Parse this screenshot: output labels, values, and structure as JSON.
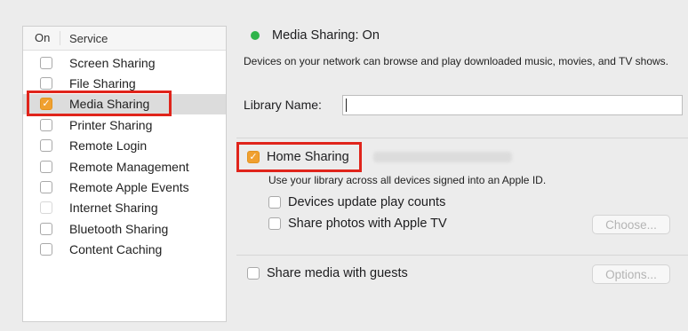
{
  "services": {
    "header_on": "On",
    "header_service": "Service",
    "items": [
      {
        "label": "Screen Sharing",
        "checked": false
      },
      {
        "label": "File Sharing",
        "checked": false
      },
      {
        "label": "Media Sharing",
        "checked": true,
        "selected": true
      },
      {
        "label": "Printer Sharing",
        "checked": false
      },
      {
        "label": "Remote Login",
        "checked": false
      },
      {
        "label": "Remote Management",
        "checked": false
      },
      {
        "label": "Remote Apple Events",
        "checked": false
      },
      {
        "label": "Internet Sharing",
        "checked": false,
        "disabled": true
      },
      {
        "label": "Bluetooth Sharing",
        "checked": false
      },
      {
        "label": "Content Caching",
        "checked": false
      }
    ]
  },
  "detail": {
    "status": "Media Sharing: On",
    "status_color": "#2fb44a",
    "description": "Devices on your network can browse and play downloaded music, movies, and TV shows.",
    "library_label": "Library Name:",
    "library_value": "",
    "home_sharing": {
      "label": "Home Sharing",
      "checked": true
    },
    "home_sharing_desc": "Use your library across all devices signed into an Apple ID.",
    "play_counts": {
      "label": "Devices update play counts",
      "checked": false
    },
    "share_photos": {
      "label": "Share photos with Apple TV",
      "checked": false
    },
    "choose_button": "Choose...",
    "guests": {
      "label": "Share media with guests",
      "checked": false
    },
    "options_button": "Options..."
  },
  "highlight_color": "#e0241b",
  "checkbox_accent": "#f0a030"
}
